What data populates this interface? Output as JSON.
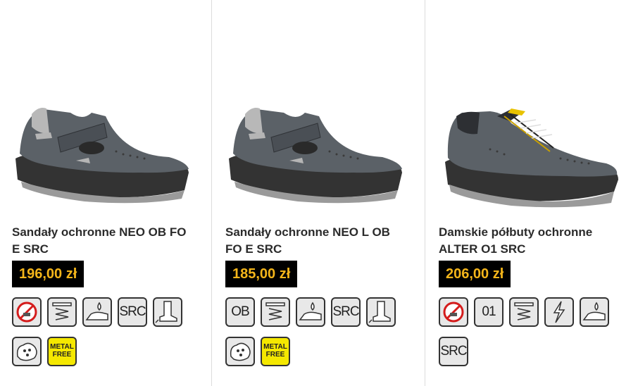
{
  "products": [
    {
      "title": "Sandały ochronne NEO OB FO E SRC",
      "price": "196,00 zł",
      "image": "grey-suede-safety-sandal",
      "icons": [
        "no-metal-icon",
        "energy-absorption-icon",
        "fuel-oil-resistant-icon",
        "src-badge",
        "antistatic-boot-icon",
        "perforated-upper-icon",
        "metal-free-badge"
      ],
      "labels": {
        "src": "SRC",
        "metal_line1": "METAL",
        "metal_line2": "FREE"
      }
    },
    {
      "title": "Sandały ochronne NEO L OB FO E SRC",
      "price": "185,00 zł",
      "image": "grey-suede-safety-sandal",
      "icons": [
        "ob-badge",
        "energy-absorption-icon",
        "fuel-oil-resistant-icon",
        "src-badge",
        "antistatic-boot-icon",
        "perforated-upper-icon",
        "metal-free-badge"
      ],
      "labels": {
        "ob": "OB",
        "src": "SRC",
        "metal_line1": "METAL",
        "metal_line2": "FREE"
      }
    },
    {
      "title": "Damskie półbuty ochronne ALTER O1 SRC",
      "price": "206,00 zł",
      "image": "grey-suede-safety-shoe",
      "icons": [
        "no-metal-icon",
        "o1-badge",
        "energy-absorption-icon",
        "antistatic-icon",
        "fuel-oil-resistant-icon",
        "src-badge"
      ],
      "labels": {
        "o1": "01",
        "src": "SRC"
      }
    }
  ],
  "colors": {
    "price_bg": "#000000",
    "price_text": "#f4b51a",
    "metal_free_bg": "#f5e800",
    "icon_bg": "#e8e8e8"
  }
}
